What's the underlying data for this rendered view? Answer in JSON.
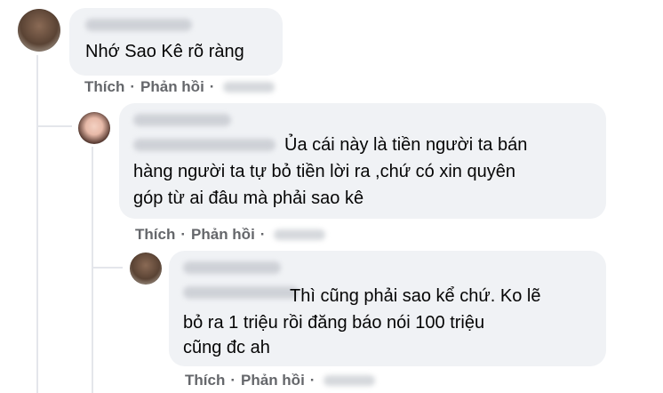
{
  "comments": [
    {
      "text_lines": [
        "Nhớ Sao Kê rõ ràng"
      ],
      "like_label": "Thích",
      "reply_label": "Phản hồi",
      "separator": "·"
    },
    {
      "text_lines": [
        "Ủa cái này là tiền người ta bán",
        "hàng người ta tự bỏ tiền lời ra ,chứ có xin quyên",
        "góp từ ai đâu mà phải sao kê"
      ],
      "like_label": "Thích",
      "reply_label": "Phản hồi",
      "separator": "·"
    },
    {
      "text_lines": [
        "Thì cũng phải sao kể chứ. Ko lẽ",
        "bỏ ra 1 triệu rồi đăng báo nói 100 triệu",
        "cũng đc ah"
      ],
      "like_label": "Thích",
      "reply_label": "Phản hồi",
      "separator": "·"
    }
  ]
}
